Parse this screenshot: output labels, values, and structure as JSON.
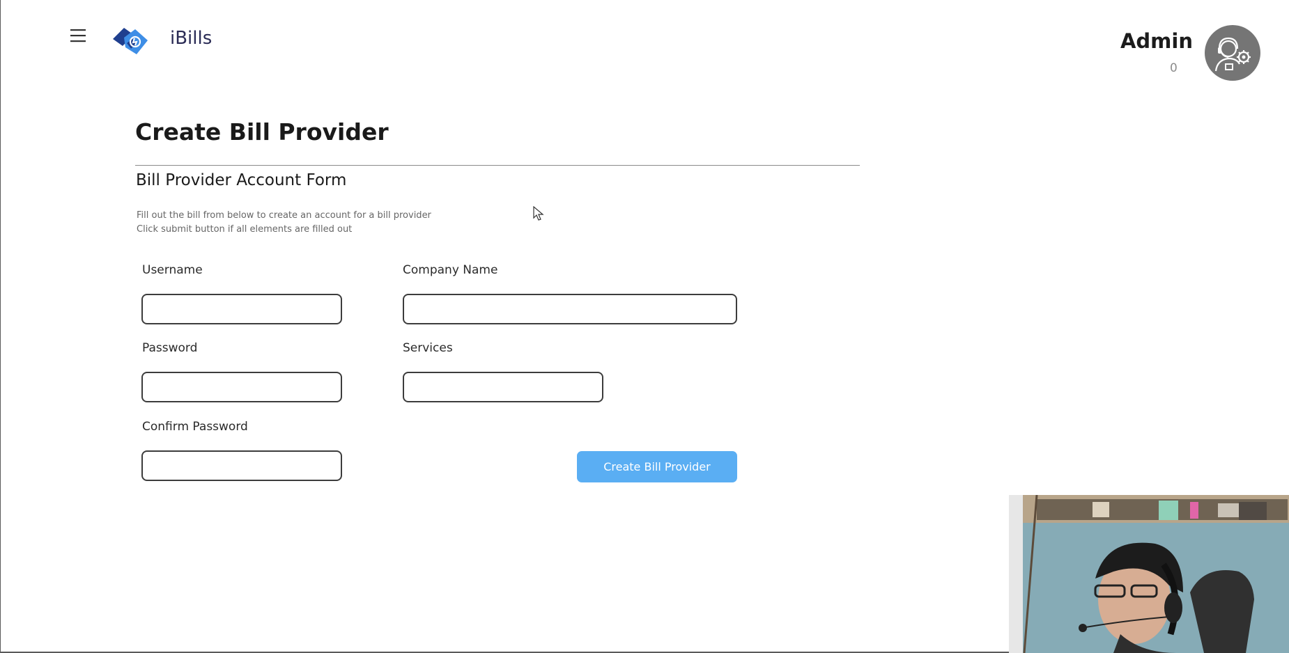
{
  "header": {
    "menu_icon": "hamburger-menu-icon",
    "logo_icon": "ibills-logo-icon",
    "app_name": "iBills",
    "user": {
      "name": "Admin",
      "count": "0",
      "avatar_icon": "admin-support-avatar-icon"
    }
  },
  "main": {
    "page_title": "Create Bill Provider",
    "form_title": "Bill Provider Account Form",
    "description_line1": "Fill out the bill from below to create an account for a bill provider",
    "description_line2": "Click submit button if all elements are filled out",
    "fields": {
      "username": {
        "label": "Username",
        "value": "",
        "placeholder": ""
      },
      "company_name": {
        "label": "Company Name",
        "value": "",
        "placeholder": ""
      },
      "password": {
        "label": "Password",
        "value": "",
        "placeholder": ""
      },
      "services": {
        "label": "Services",
        "value": "",
        "placeholder": ""
      },
      "confirm_password": {
        "label": "Confirm Password",
        "value": "",
        "placeholder": ""
      }
    },
    "submit_label": "Create Bill Provider"
  },
  "overlay": {
    "cursor_icon": "mouse-pointer-icon",
    "webcam_feed": "webcam-overlay"
  },
  "colors": {
    "accent": "#5aaef3",
    "logo_dark": "#1f3f8f",
    "logo_light": "#3e8ee6",
    "app_name": "#2a2b55",
    "avatar_bg": "#757575"
  }
}
